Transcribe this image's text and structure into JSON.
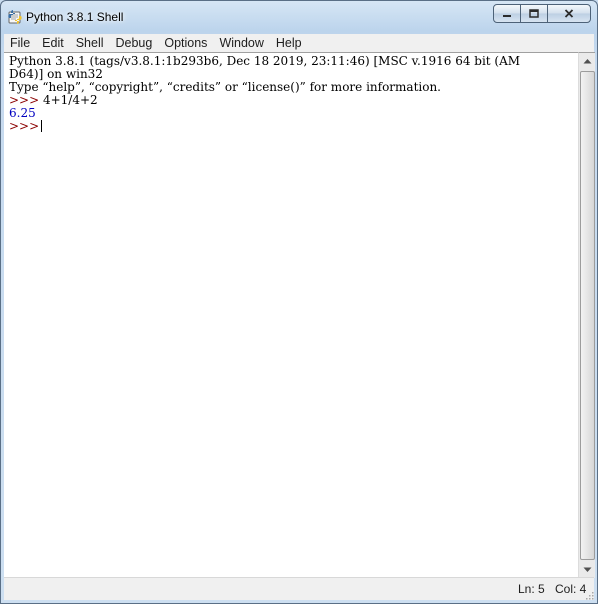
{
  "window": {
    "title": "Python 3.8.1 Shell",
    "icon": "python-idle-icon",
    "controls": [
      "minimize-icon",
      "maximize-icon",
      "close-icon"
    ]
  },
  "menu": [
    "File",
    "Edit",
    "Shell",
    "Debug",
    "Options",
    "Window",
    "Help"
  ],
  "shell": {
    "banner_line1": "Python 3.8.1 (tags/v3.8.1:1b293b6, Dec 18 2019, 23:11:46) [MSC v.1916 64 bit (AM",
    "banner_line2": "D64)] on win32",
    "banner_line3": "Type “help”, “copyright”, “credits” or “license()” for more information.",
    "prompt": ">>>",
    "input": " 4+1/4+2",
    "output": "6.25",
    "current_prompt": ">>>"
  },
  "status": {
    "ln": "Ln: 5",
    "col": "Col: 4"
  },
  "colors": {
    "prompt": "#8b0000",
    "output": "#0000c0"
  }
}
